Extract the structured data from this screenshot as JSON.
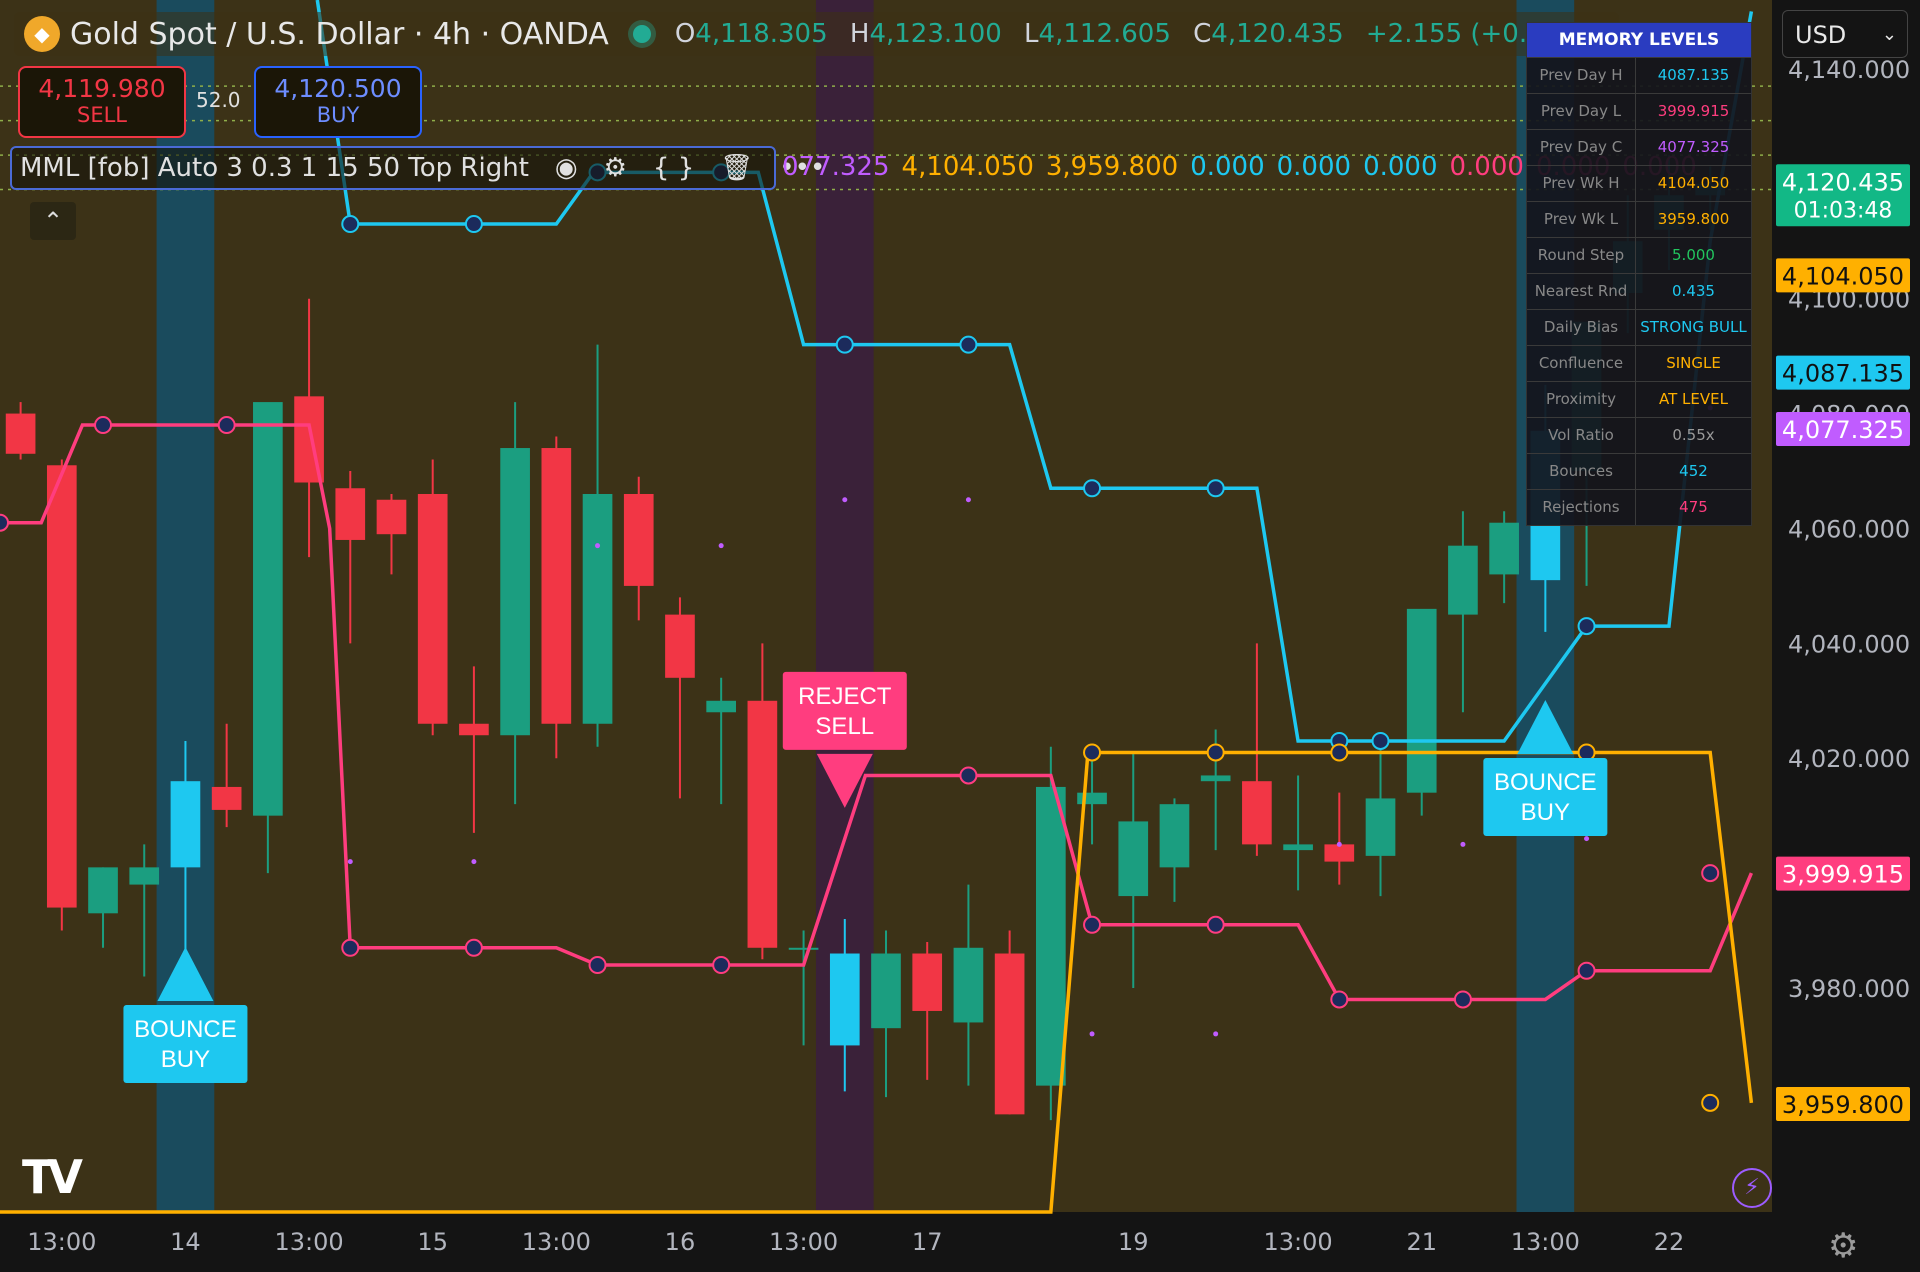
{
  "header": {
    "symbol_text": "Gold Spot / U.S. Dollar · 4h · OANDA",
    "logo_icon": "gold-coin-icon",
    "o_label": "O",
    "o_value": "4,118.305",
    "h_label": "H",
    "h_value": "4,123.100",
    "l_label": "L",
    "l_value": "4,112.605",
    "c_label": "C",
    "c_value": "4,120.435",
    "change": "+2.155 (+0.05%)"
  },
  "trade": {
    "sell_price": "4,119.980",
    "sell_label": "SELL",
    "spread": "52.0",
    "buy_price": "4,120.500",
    "buy_label": "BUY"
  },
  "indicator": {
    "name": "MML [fob] Auto 3 0.3 1 15 50 Top Right",
    "values": [
      {
        "text": "077.325",
        "color": "#c05cff"
      },
      {
        "text": "4,104.050",
        "color": "#ffb000"
      },
      {
        "text": "3,959.800",
        "color": "#ffb000"
      },
      {
        "text": "0.000",
        "color": "#1ec8f0"
      },
      {
        "text": "0.000",
        "color": "#1ec8f0"
      },
      {
        "text": "0.000",
        "color": "#1ec8f0"
      },
      {
        "text": "0.000",
        "color": "#ff3d7f"
      },
      {
        "text": "0.000",
        "color": "#ff3d7f"
      },
      {
        "text": "0.000",
        "color": "#ff3d7f"
      }
    ],
    "collapse_icon": "chevron-up-icon"
  },
  "memory": {
    "title": "MEMORY LEVELS",
    "rows": [
      {
        "k": "Prev Day H",
        "v": "4087.135",
        "c": "#1ec8f0"
      },
      {
        "k": "Prev Day L",
        "v": "3999.915",
        "c": "#ff3d7f"
      },
      {
        "k": "Prev Day C",
        "v": "4077.325",
        "c": "#c05cff"
      },
      {
        "k": "Prev Wk H",
        "v": "4104.050",
        "c": "#ffb000"
      },
      {
        "k": "Prev Wk L",
        "v": "3959.800",
        "c": "#ffb000"
      },
      {
        "k": "Round Step",
        "v": "5.000",
        "c": "#22c55e"
      },
      {
        "k": "Nearest Rnd",
        "v": "0.435",
        "c": "#1ec8f0"
      },
      {
        "k": "Daily Bias",
        "v": "STRONG BULL",
        "c": "#1ec8f0"
      },
      {
        "k": "Confluence",
        "v": "SINGLE",
        "c": "#ffb000"
      },
      {
        "k": "Proximity",
        "v": "AT LEVEL",
        "c": "#ffb000"
      },
      {
        "k": "Vol Ratio",
        "v": "0.55x",
        "c": "#9a9a9a"
      },
      {
        "k": "Bounces",
        "v": "452",
        "c": "#1ec8f0"
      },
      {
        "k": "Rejections",
        "v": "475",
        "c": "#ff3d7f"
      }
    ]
  },
  "currency": "USD",
  "colors": {
    "bull": "#1b9e80",
    "bear": "#f23645",
    "cyan": "#1ec8f0",
    "pink": "#ff3d7f",
    "orange": "#ffb000",
    "purple": "#c05cff"
  },
  "chart_data": {
    "type": "candlestick",
    "yticks": [
      "4,140.000",
      "4,100.000",
      "4,080.000",
      "4,060.000",
      "4,040.000",
      "4,020.000",
      "3,980.000"
    ],
    "xticks": [
      {
        "i": 1.0,
        "label": "13:00"
      },
      {
        "i": 4.0,
        "label": "14"
      },
      {
        "i": 7.0,
        "label": "13:00"
      },
      {
        "i": 10.0,
        "label": "15"
      },
      {
        "i": 13.0,
        "label": "13:00"
      },
      {
        "i": 16.0,
        "label": "16"
      },
      {
        "i": 19.0,
        "label": "13:00"
      },
      {
        "i": 22.0,
        "label": "17"
      },
      {
        "i": 27.0,
        "label": "19"
      },
      {
        "i": 31.0,
        "label": "13:00"
      },
      {
        "i": 34.0,
        "label": "21"
      },
      {
        "i": 37.0,
        "label": "13:00"
      },
      {
        "i": 40.0,
        "label": "22"
      }
    ],
    "candles": [
      {
        "o": 4080,
        "h": 4082,
        "l": 4072,
        "c": 4073,
        "hl": false
      },
      {
        "o": 4071,
        "h": 4072,
        "l": 3990,
        "c": 3994,
        "hl": false
      },
      {
        "o": 3993,
        "h": 4001,
        "l": 3987,
        "c": 4001,
        "hl": false
      },
      {
        "o": 3998,
        "h": 4005,
        "l": 3982,
        "c": 4001,
        "hl": false
      },
      {
        "o": 4001,
        "h": 4023,
        "l": 3985,
        "c": 4016,
        "hl": true
      },
      {
        "o": 4015,
        "h": 4026,
        "l": 4008,
        "c": 4011,
        "hl": false
      },
      {
        "o": 4010,
        "h": 4073,
        "l": 4000,
        "c": 4082,
        "hl": false
      },
      {
        "o": 4083,
        "h": 4100,
        "l": 4055,
        "c": 4068,
        "hl": false
      },
      {
        "o": 4067,
        "h": 4070,
        "l": 4040,
        "c": 4058,
        "hl": false
      },
      {
        "o": 4065,
        "h": 4066,
        "l": 4052,
        "c": 4059,
        "hl": false
      },
      {
        "o": 4066,
        "h": 4072,
        "l": 4024,
        "c": 4026,
        "hl": false
      },
      {
        "o": 4026,
        "h": 4036,
        "l": 4007,
        "c": 4024,
        "hl": false
      },
      {
        "o": 4024,
        "h": 4082,
        "l": 4012,
        "c": 4074,
        "hl": false
      },
      {
        "o": 4074,
        "h": 4076,
        "l": 4020,
        "c": 4026,
        "hl": false
      },
      {
        "o": 4026,
        "h": 4092,
        "l": 4022,
        "c": 4066,
        "hl": false
      },
      {
        "o": 4066,
        "h": 4069,
        "l": 4044,
        "c": 4050,
        "hl": false
      },
      {
        "o": 4045,
        "h": 4048,
        "l": 4013,
        "c": 4034,
        "hl": false
      },
      {
        "o": 4028,
        "h": 4034,
        "l": 4012,
        "c": 4030,
        "hl": false
      },
      {
        "o": 4030,
        "h": 4040,
        "l": 3985,
        "c": 3987,
        "hl": false
      },
      {
        "o": 3987,
        "h": 3990,
        "l": 3970,
        "c": 3987,
        "hl": false
      },
      {
        "o": 3986,
        "h": 3992,
        "l": 3962,
        "c": 3970,
        "hl": true
      },
      {
        "o": 3973,
        "h": 3990,
        "l": 3961,
        "c": 3986,
        "hl": false
      },
      {
        "o": 3986,
        "h": 3988,
        "l": 3964,
        "c": 3976,
        "hl": false
      },
      {
        "o": 3974,
        "h": 3998,
        "l": 3963,
        "c": 3987,
        "hl": false
      },
      {
        "o": 3986,
        "h": 3990,
        "l": 3958,
        "c": 3958,
        "hl": false
      },
      {
        "o": 3963,
        "h": 4022,
        "l": 3957,
        "c": 4015,
        "hl": false
      },
      {
        "o": 4012,
        "h": 4020,
        "l": 4005,
        "c": 4014,
        "hl": false
      },
      {
        "o": 3996,
        "h": 4021,
        "l": 3980,
        "c": 4009,
        "hl": false
      },
      {
        "o": 4001,
        "h": 4013,
        "l": 3995,
        "c": 4012,
        "hl": false
      },
      {
        "o": 4016,
        "h": 4025,
        "l": 4004,
        "c": 4017,
        "hl": false
      },
      {
        "o": 4016,
        "h": 4040,
        "l": 4003,
        "c": 4005,
        "hl": false
      },
      {
        "o": 4004,
        "h": 4017,
        "l": 3997,
        "c": 4005,
        "hl": false
      },
      {
        "o": 4005,
        "h": 4014,
        "l": 3998,
        "c": 4002,
        "hl": false
      },
      {
        "o": 4003,
        "h": 4022,
        "l": 3996,
        "c": 4013,
        "hl": false
      },
      {
        "o": 4014,
        "h": 4042,
        "l": 4010,
        "c": 4046,
        "hl": false
      },
      {
        "o": 4045,
        "h": 4063,
        "l": 4028,
        "c": 4057,
        "hl": false
      },
      {
        "o": 4052,
        "h": 4063,
        "l": 4047,
        "c": 4061,
        "hl": false
      },
      {
        "o": 4051,
        "h": 4085,
        "l": 4042,
        "c": 4077,
        "hl": true
      },
      {
        "o": 4070,
        "h": 4086,
        "l": 4050,
        "c": 4096,
        "hl": false
      },
      {
        "o": 4101,
        "h": 4118,
        "l": 4094,
        "c": 4110,
        "hl": false
      },
      {
        "o": 4112,
        "h": 4125,
        "l": 4105,
        "c": 4118,
        "hl": false
      },
      {
        "o": 4118,
        "h": 4123,
        "l": 4112,
        "c": 4120,
        "hl": false
      }
    ],
    "highlight_bands": [
      {
        "i": 4.0,
        "color": "#14506a"
      },
      {
        "i": 20.0,
        "color": "#3a1e40"
      },
      {
        "i": 37.0,
        "color": "#14506a"
      }
    ],
    "lines": [
      {
        "name": "",
        "color": "#1ec8f0",
        "points": [
          [
            7.2,
            4152
          ],
          [
            8.0,
            4113
          ],
          [
            12.0,
            4113
          ],
          [
            13.0,
            4113
          ],
          [
            13.9,
            4122
          ],
          [
            16.9,
            4122
          ],
          [
            17.9,
            4122
          ],
          [
            19.0,
            4092
          ],
          [
            21.0,
            4092
          ],
          [
            24.0,
            4092
          ],
          [
            25.0,
            4067
          ],
          [
            27.0,
            4067
          ],
          [
            30.0,
            4067
          ],
          [
            31.0,
            4023
          ],
          [
            33.0,
            4023
          ],
          [
            36.0,
            4023
          ],
          [
            38.0,
            4043
          ],
          [
            40.0,
            4043
          ],
          [
            41.0,
            4110
          ],
          [
            42.0,
            4150
          ]
        ]
      },
      {
        "name": "",
        "color": "#ff3d7f",
        "points": [
          [
            -0.5,
            4061
          ],
          [
            0.5,
            4061
          ],
          [
            1.5,
            4078
          ],
          [
            3.0,
            4078
          ],
          [
            6.0,
            4078
          ],
          [
            7.0,
            4078
          ],
          [
            7.5,
            4060
          ],
          [
            8.0,
            3987
          ],
          [
            12.0,
            3987
          ],
          [
            13.0,
            3987
          ],
          [
            14.0,
            3984
          ],
          [
            17.0,
            3984
          ],
          [
            18.0,
            3984
          ],
          [
            19.0,
            3984
          ],
          [
            20.5,
            4017
          ],
          [
            24.0,
            4017
          ],
          [
            25.0,
            4017
          ],
          [
            26.0,
            3991
          ],
          [
            30.0,
            3991
          ],
          [
            31.0,
            3991
          ],
          [
            32.0,
            3978
          ],
          [
            35.0,
            3978
          ],
          [
            36.0,
            3978
          ],
          [
            37.0,
            3978
          ],
          [
            38.0,
            3983
          ],
          [
            40.0,
            3983
          ],
          [
            41.0,
            3983
          ],
          [
            42.0,
            4000
          ]
        ]
      },
      {
        "name": "",
        "color": "#ffb000",
        "points": [
          [
            -0.5,
            3941
          ],
          [
            24.0,
            3941
          ],
          [
            25.0,
            3941
          ],
          [
            25.9,
            4021
          ],
          [
            30.0,
            4021
          ],
          [
            33.0,
            4021
          ],
          [
            39.0,
            4021
          ],
          [
            40.0,
            4021
          ],
          [
            41.0,
            4021
          ],
          [
            42.0,
            3960
          ]
        ]
      }
    ],
    "line_markers": [
      {
        "color": "#1ec8f0",
        "pts": [
          [
            8,
            4113
          ],
          [
            11,
            4113
          ],
          [
            14,
            4122
          ],
          [
            17,
            4122
          ],
          [
            20,
            4092
          ],
          [
            23,
            4092
          ],
          [
            26,
            4067
          ],
          [
            29,
            4067
          ],
          [
            32,
            4023
          ],
          [
            33,
            4023
          ],
          [
            38,
            4043
          ]
        ]
      },
      {
        "color": "#ff3d7f",
        "pts": [
          [
            -0.5,
            4061
          ],
          [
            2,
            4078
          ],
          [
            5,
            4078
          ],
          [
            8,
            3987
          ],
          [
            11,
            3987
          ],
          [
            14,
            3984
          ],
          [
            17,
            3984
          ],
          [
            23,
            4017
          ],
          [
            26,
            3991
          ],
          [
            29,
            3991
          ],
          [
            32,
            3978
          ],
          [
            35,
            3978
          ],
          [
            38,
            3983
          ],
          [
            41,
            4000
          ]
        ]
      },
      {
        "color": "#ffb000",
        "pts": [
          [
            26,
            4021
          ],
          [
            29,
            4021
          ],
          [
            32,
            4021
          ],
          [
            38,
            4021
          ],
          [
            41,
            3960
          ]
        ]
      },
      {
        "color": "#c05cff",
        "pts": [
          [
            14,
            4057
          ],
          [
            17,
            4057
          ],
          [
            20,
            4065
          ],
          [
            23,
            4065
          ],
          [
            8,
            4002
          ],
          [
            11,
            4002
          ],
          [
            26,
            3972
          ],
          [
            29,
            3972
          ],
          [
            32,
            4005
          ],
          [
            35,
            4005
          ],
          [
            38,
            4006
          ],
          [
            41,
            4081
          ]
        ]
      }
    ],
    "dotted_levels": [
      {
        "y": 4137,
        "color": "#8fae4a"
      },
      {
        "y": 4131,
        "color": "#8fae4a"
      },
      {
        "y": 4125,
        "color": "#8fae4a"
      },
      {
        "y": 4119,
        "color": "#8fae4a"
      }
    ],
    "signals": [
      {
        "i": 4.0,
        "y": 3984,
        "dir": "up",
        "label1": "BOUNCE",
        "label2": "BUY",
        "color": "#1ec8f0"
      },
      {
        "i": 20.0,
        "y": 4011,
        "dir": "down",
        "label1": "REJECT",
        "label2": "SELL",
        "color": "#ff3d7f"
      },
      {
        "i": 37.0,
        "y": 4027,
        "dir": "up",
        "label1": "BOUNCE",
        "label2": "BUY",
        "color": "#1ec8f0"
      }
    ],
    "price_tags": [
      {
        "y": 4120.435,
        "text": "4,120.435",
        "text2": "01:03:48",
        "bg": "#12b886",
        "fg": "#ffffff"
      },
      {
        "y": 4104.05,
        "text": "4,104.050",
        "bg": "#ffb000",
        "fg": "#111111"
      },
      {
        "y": 4087.135,
        "text": "4,087.135",
        "bg": "#1ec8f0",
        "fg": "#111111"
      },
      {
        "y": 4077.325,
        "text": "4,077.325",
        "bg": "#c05cff",
        "fg": "#ffffff"
      },
      {
        "y": 3999.915,
        "text": "3,999.915",
        "bg": "#ff3d7f",
        "fg": "#ffffff"
      },
      {
        "y": 3959.8,
        "text": "3,959.800",
        "bg": "#ffb000",
        "fg": "#111111"
      }
    ],
    "ylim": [
      3941,
      4152
    ],
    "xlim": [
      -0.5,
      42.5
    ]
  }
}
